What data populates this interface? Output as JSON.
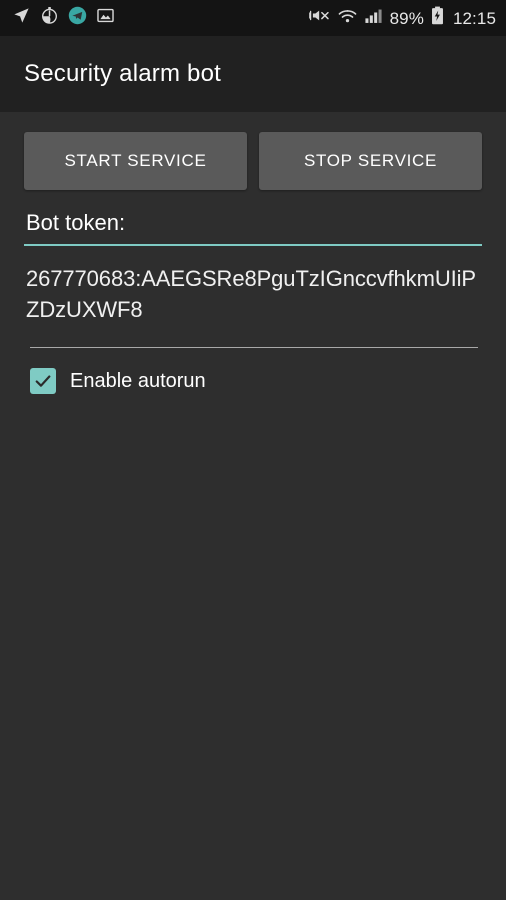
{
  "status_bar": {
    "left_icons": [
      {
        "name": "location-arrow-icon",
        "label": "location"
      },
      {
        "name": "alarm-clock-icon",
        "label": "alarm"
      },
      {
        "name": "telegram-bot-icon",
        "label": "security alarm bot"
      },
      {
        "name": "screenshot-image-icon",
        "label": "screenshot"
      }
    ],
    "right_icons": [
      {
        "name": "vibrate-mute-icon",
        "label": "sound off"
      },
      {
        "name": "wifi-icon",
        "label": "wifi"
      },
      {
        "name": "cell-signal-icon",
        "label": "signal"
      }
    ],
    "battery_percent": "89%",
    "battery_state": "charging",
    "clock": "12:15"
  },
  "app_bar": {
    "title": "Security alarm bot"
  },
  "main": {
    "start_service_label": "START SERVICE",
    "stop_service_label": "STOP SERVICE",
    "token_label": "Bot token:",
    "token_value": "267770683:AAEGSRe8PguTzIGnccvfhkmUIiPZDzUXWF8",
    "token_placeholder": "Bot token",
    "autorun_label": "Enable autorun",
    "autorun_checked": true
  },
  "colors": {
    "background": "#2e2e2e",
    "app_bar": "#212121",
    "status_bar": "#141414",
    "accent": "#7fcbc4",
    "button": "#5a5a5a",
    "text": "#ffffff"
  }
}
